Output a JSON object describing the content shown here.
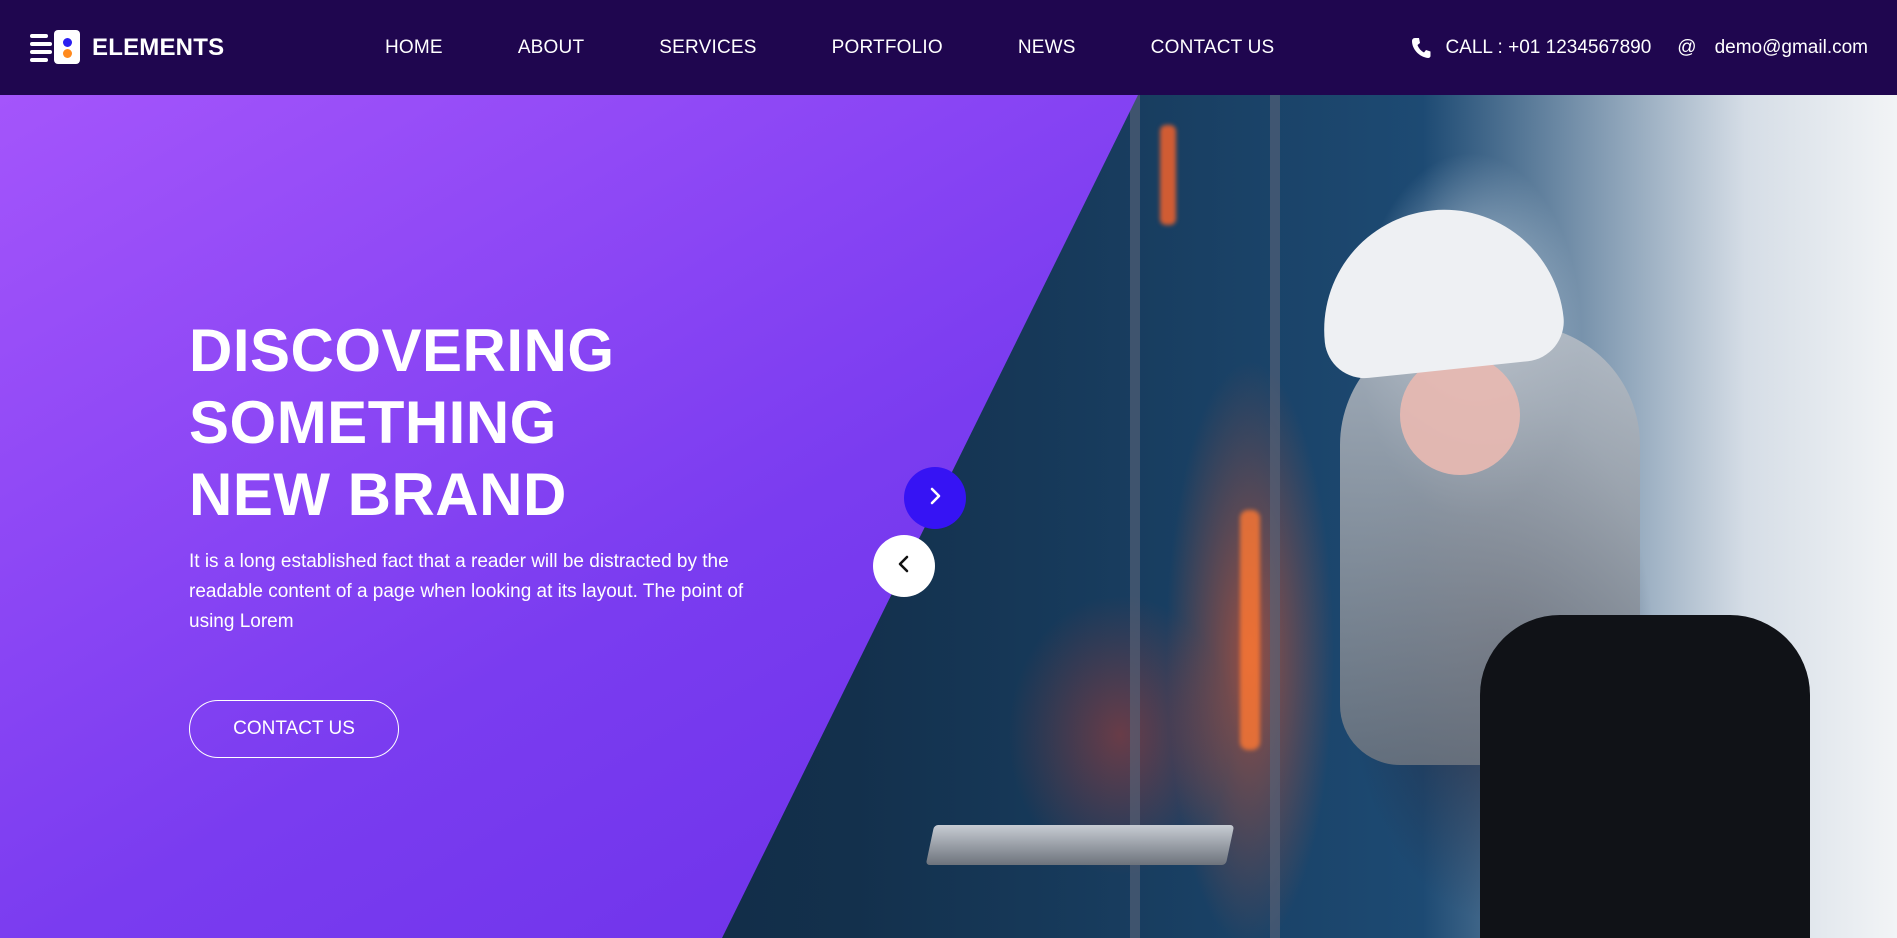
{
  "brand": {
    "name": "ELEMENTS"
  },
  "nav": {
    "items": [
      {
        "label": "HOME"
      },
      {
        "label": "ABOUT"
      },
      {
        "label": "SERVICES"
      },
      {
        "label": "PORTFOLIO"
      },
      {
        "label": "NEWS"
      },
      {
        "label": "CONTACT US"
      }
    ]
  },
  "contact": {
    "phone_text": "CALL : +01 1234567890",
    "email_symbol": "@",
    "email_text": "demo@gmail.com",
    "phone_icon": "phone-icon"
  },
  "hero": {
    "title_lines": [
      "DISCOVERING",
      "SOMETHING",
      "NEW BRAND"
    ],
    "description": "It is a long established fact that a reader will be distracted by the readable content of a page when looking at its layout. The point of using Lorem",
    "button_label": "CONTACT US"
  },
  "slider": {
    "next_icon": "chevron-right-icon",
    "prev_icon": "chevron-left-icon"
  },
  "colors": {
    "header_bg": "#1f064f",
    "purple_start": "#a455fb",
    "purple_end": "#6229e4",
    "next_button": "#3613f4",
    "logo_dot_blue": "#2a1ef0",
    "logo_dot_orange": "#ff8a1e"
  }
}
